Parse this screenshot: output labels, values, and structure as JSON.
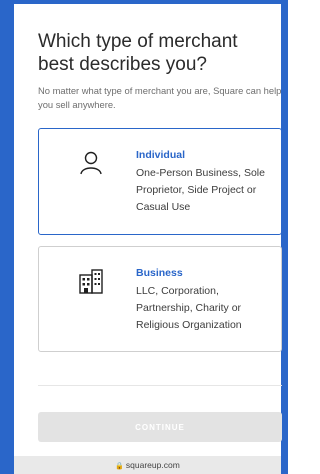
{
  "page": {
    "heading": "Which type of merchant best describes you?",
    "subtext": "No matter what type of merchant you are, Square can help you sell anywhere."
  },
  "options": [
    {
      "title": "Individual",
      "description": "One-Person Business, Sole Proprietor, Side Project or Casual Use",
      "icon": "person-icon",
      "selected": true
    },
    {
      "title": "Business",
      "description": "LLC, Corporation, Partnership, Charity or Religious Organization",
      "icon": "building-icon",
      "selected": false
    }
  ],
  "footer": {
    "continue_label": "CONTINUE"
  },
  "browser": {
    "url": "squareup.com"
  },
  "colors": {
    "accent": "#2a66c9",
    "button_disabled": "#e3e3e3"
  }
}
